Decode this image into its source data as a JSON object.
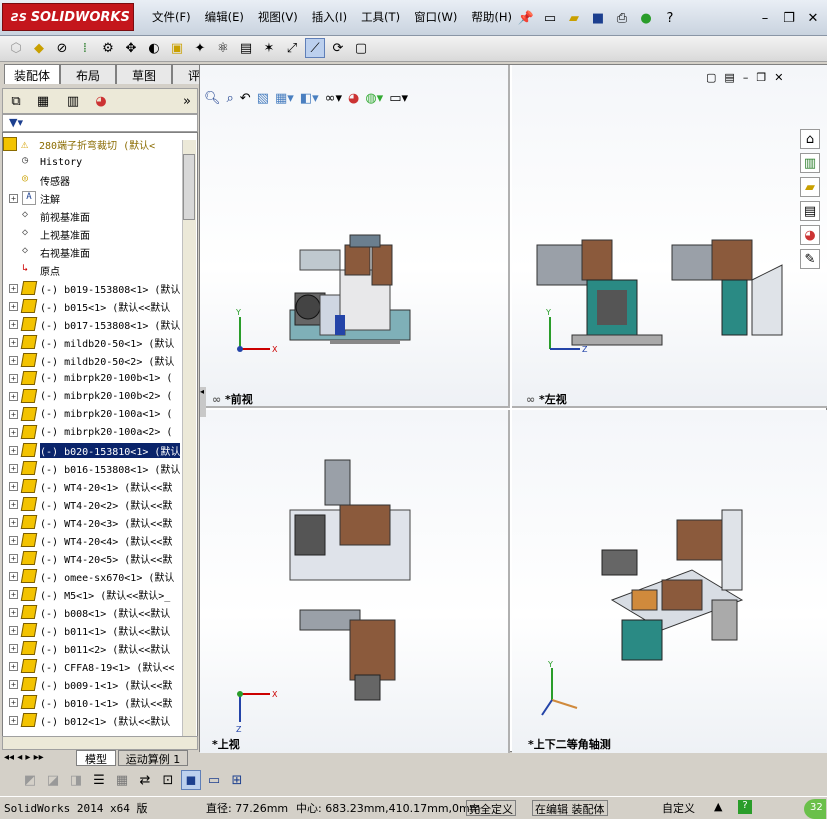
{
  "app": {
    "logo_text": "SOLIDWORKS"
  },
  "menu": [
    "文件(F)",
    "编辑(E)",
    "视图(V)",
    "插入(I)",
    "工具(T)",
    "窗口(W)",
    "帮助(H)"
  ],
  "left_tabs": [
    "装配体",
    "布局",
    "草图",
    "评估"
  ],
  "tree": {
    "root": "280端子折弯裁切  (默认<",
    "items": [
      {
        "label": "History",
        "icon": "history-icon",
        "expand": false
      },
      {
        "label": "传感器",
        "icon": "sensor-icon",
        "expand": false
      },
      {
        "label": "注解",
        "icon": "annotation-icon",
        "expand": true
      },
      {
        "label": "前视基准面",
        "icon": "plane-icon",
        "expand": false
      },
      {
        "label": "上视基准面",
        "icon": "plane-icon",
        "expand": false
      },
      {
        "label": "右视基准面",
        "icon": "plane-icon",
        "expand": false
      },
      {
        "label": "原点",
        "icon": "origin-icon",
        "expand": false
      },
      {
        "label": "(-) b019-153808<1> (默认",
        "icon": "part-icon",
        "expand": true
      },
      {
        "label": "(-) b015<1> (默认<<默认",
        "icon": "part-icon",
        "expand": true
      },
      {
        "label": "(-) b017-153808<1> (默认",
        "icon": "part-icon",
        "expand": true
      },
      {
        "label": "(-) mildb20-50<1> (默认",
        "icon": "part-icon",
        "expand": true
      },
      {
        "label": "(-) mildb20-50<2> (默认",
        "icon": "part-icon",
        "expand": true
      },
      {
        "label": "(-) mibrpk20-100b<1> (",
        "icon": "part-icon",
        "expand": true
      },
      {
        "label": "(-) mibrpk20-100b<2> (",
        "icon": "part-icon",
        "expand": true
      },
      {
        "label": "(-) mibrpk20-100a<1> (",
        "icon": "part-icon",
        "expand": true
      },
      {
        "label": "(-) mibrpk20-100a<2> (",
        "icon": "part-icon",
        "expand": true
      },
      {
        "label": "(-) b020-153810<1> (默认",
        "icon": "part-icon",
        "expand": true,
        "selected": true
      },
      {
        "label": "(-) b016-153808<1> (默认",
        "icon": "part-icon",
        "expand": true
      },
      {
        "label": "(-) WT4-20<1> (默认<<默",
        "icon": "part-icon",
        "expand": true
      },
      {
        "label": "(-) WT4-20<2> (默认<<默",
        "icon": "part-icon",
        "expand": true
      },
      {
        "label": "(-) WT4-20<3> (默认<<默",
        "icon": "part-icon",
        "expand": true
      },
      {
        "label": "(-) WT4-20<4> (默认<<默",
        "icon": "part-icon",
        "expand": true
      },
      {
        "label": "(-) WT4-20<5> (默认<<默",
        "icon": "part-icon",
        "expand": true
      },
      {
        "label": "(-) omee-sx670<1> (默认",
        "icon": "part-icon",
        "expand": true
      },
      {
        "label": "(-) M5<1> (默认<<默认>_",
        "icon": "part-icon",
        "expand": true
      },
      {
        "label": "(-) b008<1> (默认<<默认",
        "icon": "part-icon",
        "expand": true
      },
      {
        "label": "(-) b011<1> (默认<<默认",
        "icon": "part-icon",
        "expand": true
      },
      {
        "label": "(-) b011<2> (默认<<默认",
        "icon": "part-icon",
        "expand": true
      },
      {
        "label": "(-) CFFA8-19<1> (默认<<",
        "icon": "part-icon",
        "expand": true
      },
      {
        "label": "(-) b009-1<1> (默认<<默",
        "icon": "part-icon",
        "expand": true
      },
      {
        "label": "(-) b010-1<1> (默认<<默",
        "icon": "part-icon",
        "expand": true
      },
      {
        "label": "(-) b012<1> (默认<<默认",
        "icon": "part-icon",
        "expand": true
      }
    ]
  },
  "bottom_tabs": [
    "模型",
    "运动算例 1"
  ],
  "views": {
    "front": "*前视",
    "left": "*左视",
    "top": "*上视",
    "iso": "*上下二等角轴测"
  },
  "status": {
    "version": "SolidWorks 2014 x64 版",
    "diameter": "直径: 77.26mm",
    "center": "中心: 683.23mm,410.17mm,0mm",
    "defined": "完全定义",
    "editing": "在编辑 装配体",
    "custom": "自定义",
    "badge": "32"
  },
  "colors": {
    "accent": "#c4161c",
    "selection": "#0a246a"
  }
}
